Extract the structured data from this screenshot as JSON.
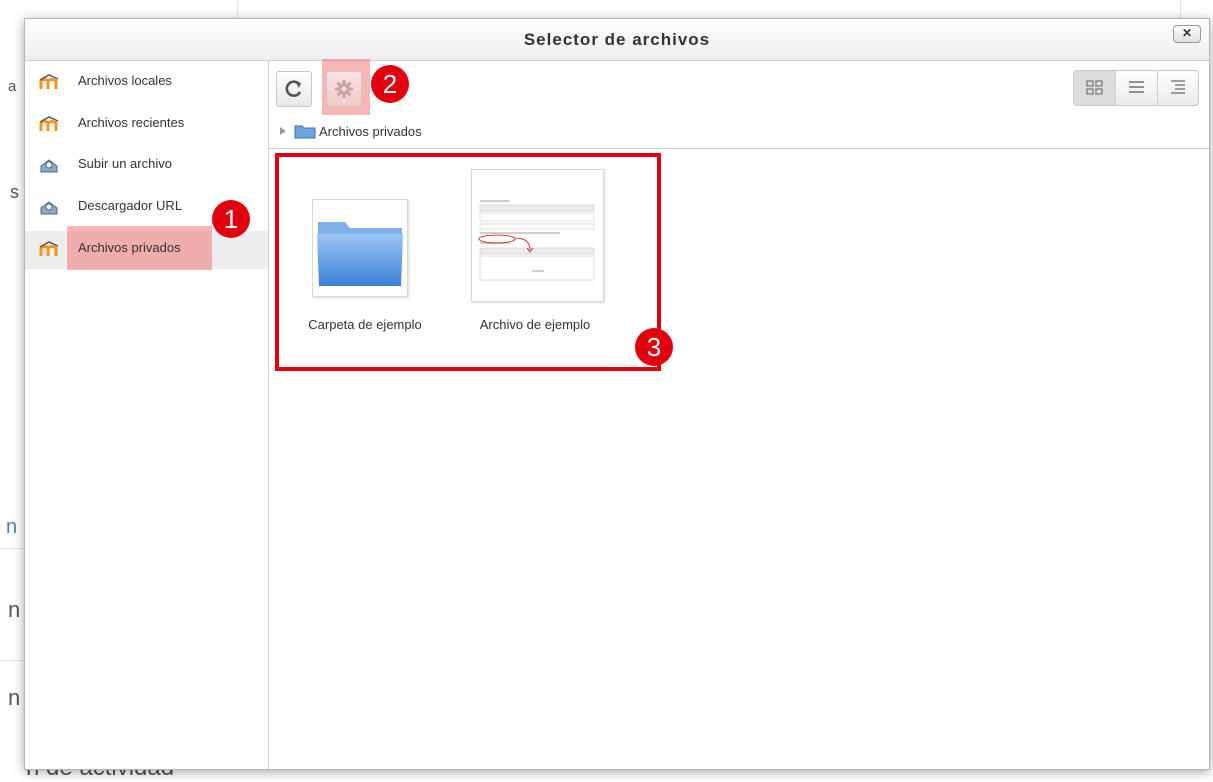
{
  "background_fragments": {
    "frag1": "a",
    "frag2": "s",
    "frag3": "n",
    "frag4": "n",
    "frag5": "n",
    "frag6": "n de actividad"
  },
  "dialog": {
    "title": "Selector de archivos",
    "close_label": "✕"
  },
  "sidebar": {
    "items": [
      {
        "label": "Archivos locales",
        "icon": "moodle-icon"
      },
      {
        "label": "Archivos recientes",
        "icon": "moodle-icon"
      },
      {
        "label": "Subir un archivo",
        "icon": "upload-icon"
      },
      {
        "label": "Descargador URL",
        "icon": "upload-icon"
      },
      {
        "label": "Archivos privados",
        "icon": "moodle-icon",
        "active": true
      }
    ]
  },
  "toolbar": {
    "refresh_icon": "refresh-icon",
    "settings_icon": "gear-icon",
    "views": [
      "icon-view",
      "list-view",
      "tree-view"
    ]
  },
  "breadcrumb": {
    "label": "Archivos privados"
  },
  "files": [
    {
      "name": "Carpeta de ejemplo",
      "type": "folder"
    },
    {
      "name": "Archivo de ejemplo",
      "type": "document"
    }
  ],
  "markers": {
    "m1": "1",
    "m2": "2",
    "m3": "3"
  },
  "colors": {
    "marker": "#e2000f",
    "highlight": "#f07878",
    "moodle_orange": "#f7931e",
    "folder_blue": "#5b9be6"
  }
}
